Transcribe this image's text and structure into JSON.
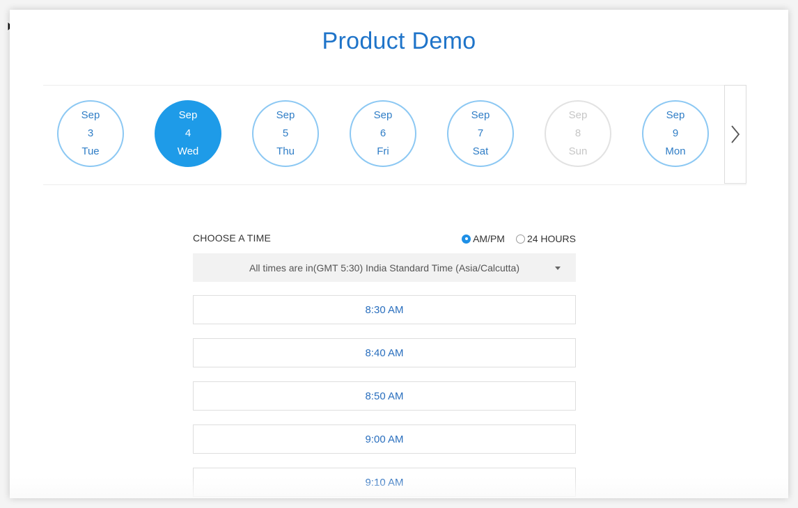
{
  "page": {
    "title": "Product Demo"
  },
  "dates": [
    {
      "month": "Sep",
      "day": "3",
      "weekday": "Tue",
      "state": "available"
    },
    {
      "month": "Sep",
      "day": "4",
      "weekday": "Wed",
      "state": "selected"
    },
    {
      "month": "Sep",
      "day": "5",
      "weekday": "Thu",
      "state": "available"
    },
    {
      "month": "Sep",
      "day": "6",
      "weekday": "Fri",
      "state": "available"
    },
    {
      "month": "Sep",
      "day": "7",
      "weekday": "Sat",
      "state": "available"
    },
    {
      "month": "Sep",
      "day": "8",
      "weekday": "Sun",
      "state": "disabled"
    },
    {
      "month": "Sep",
      "day": "9",
      "weekday": "Mon",
      "state": "available"
    }
  ],
  "time_picker": {
    "heading": "CHOOSE A TIME",
    "format_options": [
      {
        "label": "AM/PM",
        "checked": true
      },
      {
        "label": "24 HOURS",
        "checked": false
      }
    ],
    "timezone_label": "All times are in(GMT 5:30) India Standard Time (Asia/Calcutta)",
    "slots": [
      "8:30 AM",
      "8:40 AM",
      "8:50 AM",
      "9:00 AM",
      "9:10 AM"
    ]
  },
  "icons": {
    "next": "chevron-right-icon",
    "dropdown": "caret-down-icon",
    "cursor": "mouse-pointer-icon"
  },
  "colors": {
    "accent": "#1e9be8",
    "title": "#1f74c9",
    "slot_text": "#2a6fbe",
    "ring": "#8cc8f3",
    "disabled": "#c6c6c6"
  }
}
